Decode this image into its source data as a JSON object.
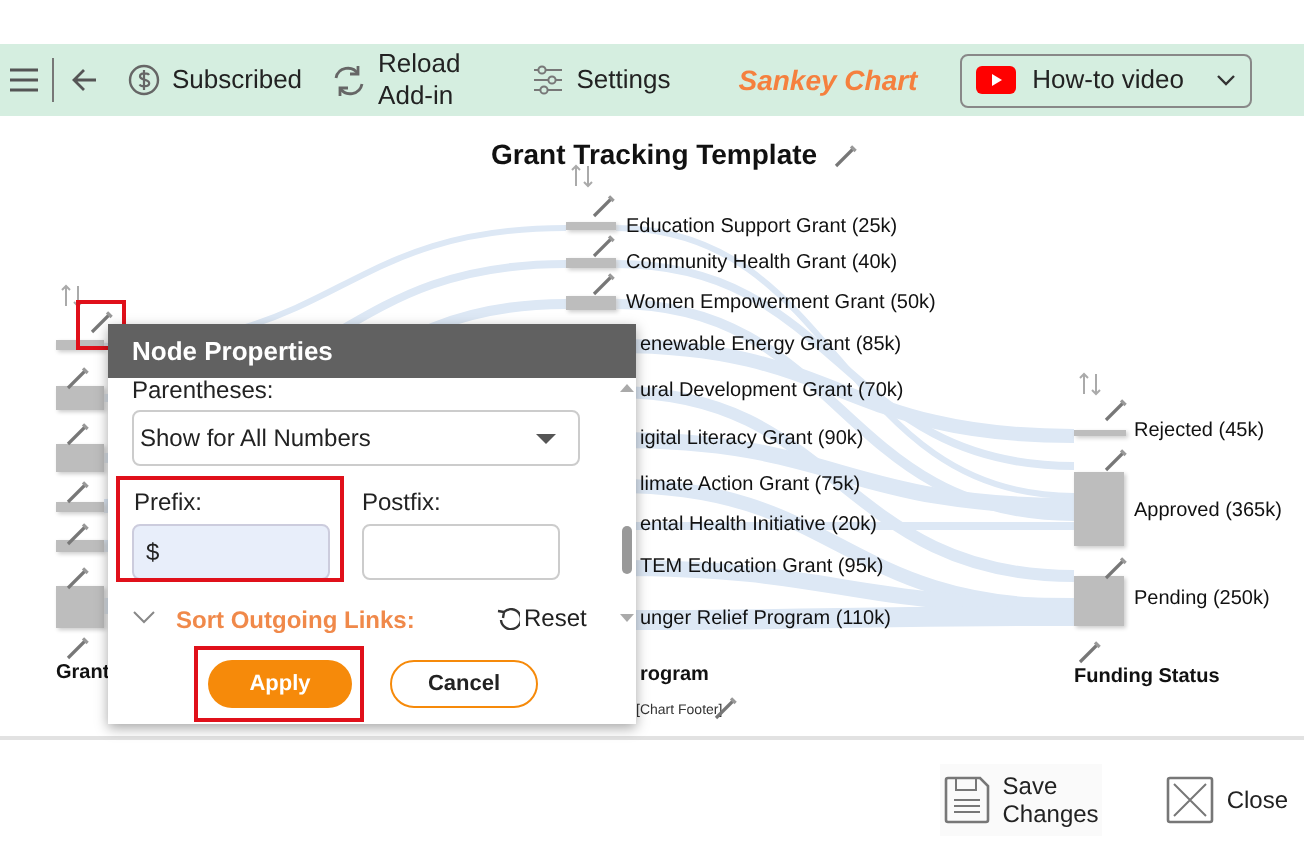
{
  "toolbar": {
    "items": [
      {
        "kind": "menu"
      },
      {
        "kind": "back"
      },
      {
        "kind": "subscribed",
        "label": "Subscribed"
      },
      {
        "kind": "reload",
        "lines": [
          "Reload",
          "Add-in"
        ]
      },
      {
        "kind": "settings",
        "label": "Settings"
      }
    ],
    "app_title": "Sankey Chart",
    "video_button": {
      "label": "How-to video"
    }
  },
  "chart": {
    "title": "Grant Tracking Template",
    "left_column": {
      "label": "Grant",
      "edit_highlighted": true
    },
    "middle_column": {
      "label": "rogram",
      "nodes": [
        {
          "label": "Education Support Grant (25k)"
        },
        {
          "label": "Community Health Grant (40k)"
        },
        {
          "label": "Women Empowerment Grant (50k)"
        },
        {
          "label": "enewable Energy Grant (85k)"
        },
        {
          "label": "ural Development Grant (70k)"
        },
        {
          "label": "igital Literacy Grant (90k)"
        },
        {
          "label": "limate Action Grant (75k)"
        },
        {
          "label": "ental Health Initiative (20k)"
        },
        {
          "label": "TEM Education Grant (95k)"
        },
        {
          "label": "unger Relief Program (110k)"
        }
      ]
    },
    "right_column": {
      "label": "Funding Status",
      "nodes": [
        {
          "label": "Rejected (45k)"
        },
        {
          "label": "Approved (365k)"
        },
        {
          "label": "Pending (250k)"
        }
      ]
    },
    "footer": "[Chart Footer]"
  },
  "dialog": {
    "title": "Node Properties",
    "parentheses_label": "Parentheses:",
    "parentheses_value": "Show for All Numbers",
    "prefix": {
      "label": "Prefix:",
      "value": "$",
      "highlighted": true
    },
    "postfix": {
      "label": "Postfix:"
    },
    "sort": {
      "label": "Sort Outgoing Links:",
      "expanded": false
    },
    "reset": "Reset",
    "apply": {
      "label": "Apply",
      "highlighted": true
    },
    "cancel": "Cancel"
  },
  "bottom_bar": {
    "save_lines": [
      "Save",
      "Changes"
    ],
    "close": "Close"
  }
}
